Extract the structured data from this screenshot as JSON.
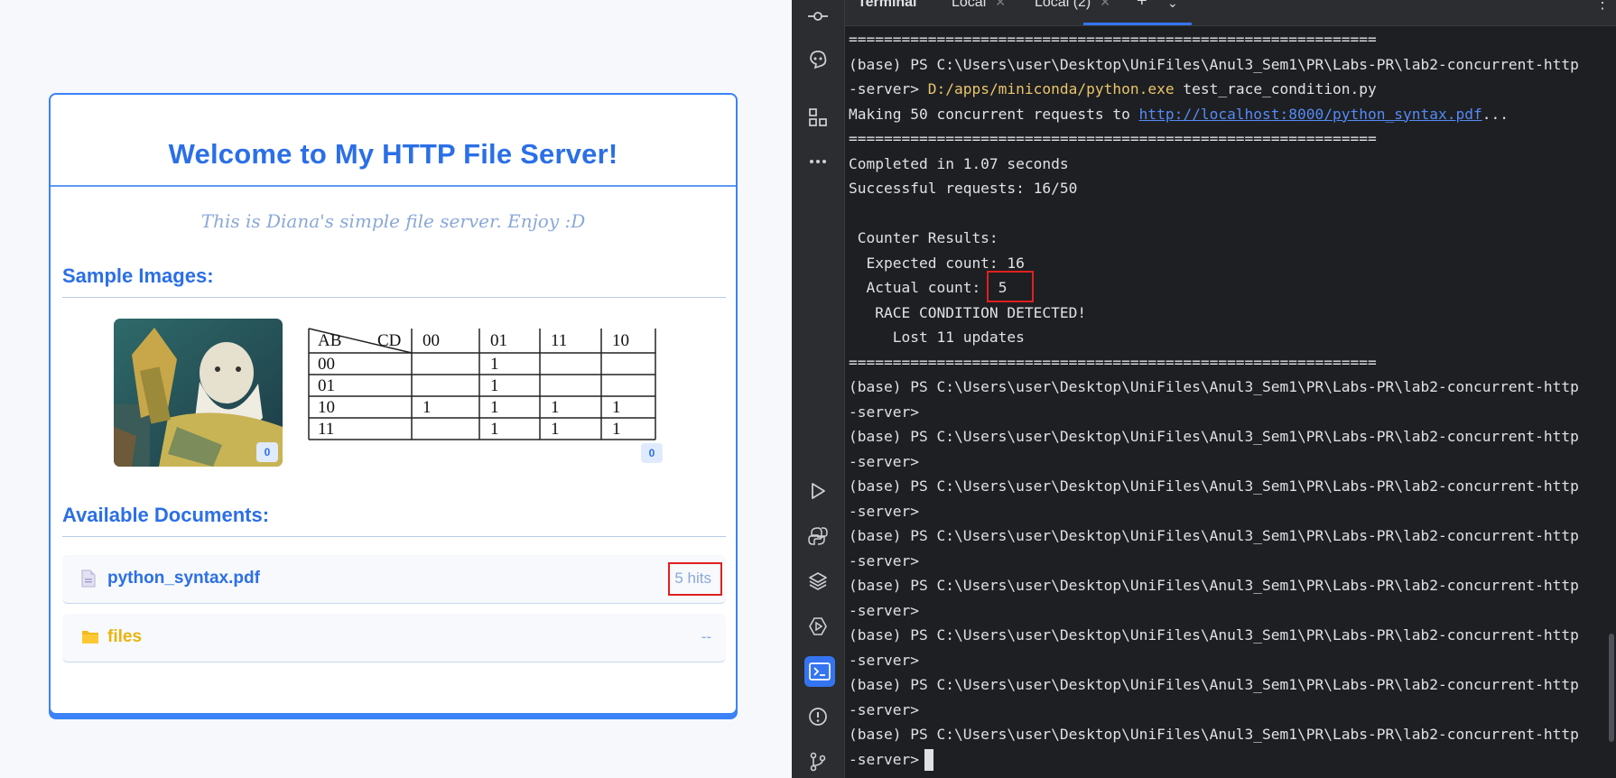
{
  "web": {
    "title": "Welcome to My HTTP File Server!",
    "subtitle": "This is Diana's simple file server. Enjoy :D",
    "images_heading": "Sample Images:",
    "documents_heading": "Available Documents:",
    "images": [
      {
        "alt": "bearded warrior illustration",
        "hits": "0"
      },
      {
        "alt": "karnaugh map table",
        "hits": "0"
      }
    ],
    "kmap": {
      "corner_row": "AB",
      "corner_col": "CD",
      "col_headers": [
        "00",
        "01",
        "11",
        "10"
      ],
      "rows": [
        {
          "label": "00",
          "cells": [
            "",
            "1",
            "",
            ""
          ]
        },
        {
          "label": "01",
          "cells": [
            "",
            "1",
            "",
            ""
          ]
        },
        {
          "label": "10",
          "cells": [
            "1",
            "1",
            "1",
            "1"
          ]
        },
        {
          "label": "11",
          "cells": [
            "",
            "1",
            "1",
            "1"
          ]
        }
      ]
    },
    "documents": [
      {
        "name": "python_syntax.pdf",
        "meta": "5 hits",
        "icon": "pdf-file-icon",
        "color": "#2b6fe6"
      },
      {
        "name": "files",
        "meta": "--",
        "icon": "folder-icon",
        "color": "#e9b40c"
      }
    ]
  },
  "ide": {
    "tabs": [
      "Terminal",
      "Local",
      "Local (2)"
    ],
    "accent": "#3574f0",
    "rail_icons": [
      "commit-icon",
      "ai-assistant-icon",
      "structure-icon",
      "more-icon",
      "run-icon",
      "python-console-icon",
      "layers-icon",
      "services-icon",
      "terminal-icon",
      "problems-icon",
      "git-icon"
    ],
    "terminal": {
      "separator": "============================================================",
      "prompt_line_a": "(base) PS C:\\Users\\user\\Desktop\\UniFiles\\Anul3_Sem1\\PR\\Labs-PR\\lab2-concurrent-http",
      "prompt_line_b": "-server> ",
      "command_exe": "D:/apps/miniconda/python.exe",
      "command_arg": " test_race_condition.py",
      "making_prefix": "Making 50 concurrent requests to ",
      "making_link": "http://localhost:8000/python_syntax.pdf",
      "making_suffix": "...",
      "completed": "Completed in 1.07 seconds",
      "successful": "Successful requests: 16/50",
      "counter_results": " Counter Results:",
      "expected": "  Expected count: 16",
      "actual_label": "  Actual count:  ",
      "actual_value": "5",
      "race": "   RACE CONDITION DETECTED!",
      "lost": "     Lost 11 updates",
      "prompt_end": "-server>"
    }
  }
}
